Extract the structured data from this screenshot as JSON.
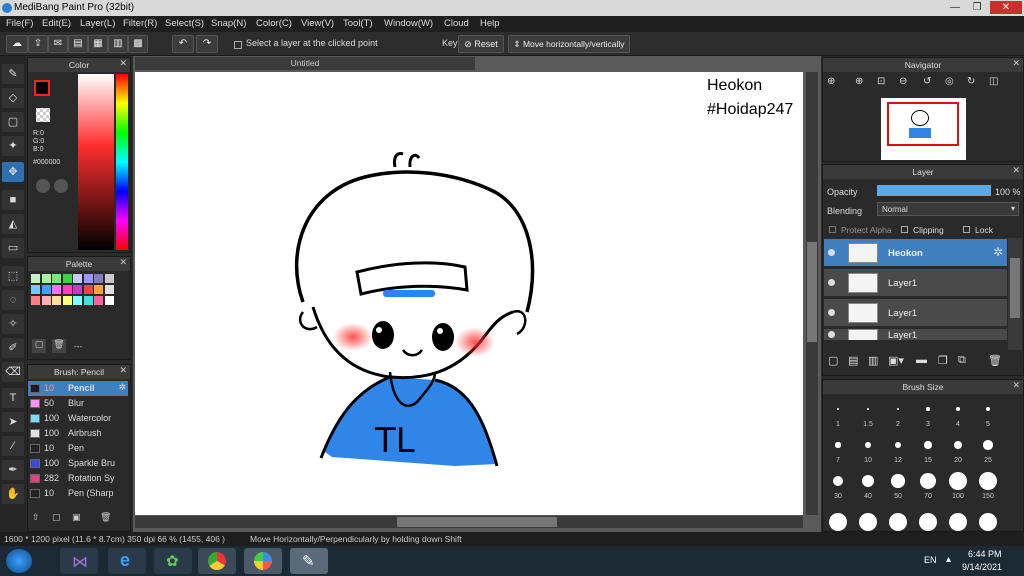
{
  "titlebar": {
    "title": "MediBang Paint Pro (32bit)"
  },
  "menu": [
    "File(F)",
    "Edit(E)",
    "Layer(L)",
    "Filter(R)",
    "Select(S)",
    "Snap(N)",
    "Color(C)",
    "View(V)",
    "Tool(T)",
    "Window(W)",
    "Cloud",
    "Help"
  ],
  "toolbar": {
    "select_layer_label": "Select a layer at the clicked point",
    "key_label": "Key",
    "reset_label": "Reset",
    "move_label": "Move horizontally/vertically"
  },
  "document": {
    "tab_title": "Untitled"
  },
  "canvas_text": {
    "line1": "Heokon",
    "line2": "#Hoidap247",
    "shirt_text": "TL"
  },
  "color_panel": {
    "title": "Color",
    "r": "R:0",
    "g": "G:0",
    "b": "B:0",
    "hex": "#000000",
    "primary": "#000000",
    "secondary": "#ff6600"
  },
  "palette_panel": {
    "title": "Palette",
    "swatches": [
      "#c8f0c8",
      "#a8f0a8",
      "#78e878",
      "#40d040",
      "#c8c8ff",
      "#9898ff",
      "#8080c0",
      "#c8c8c8",
      "#78c8ff",
      "#40a0ff",
      "#ff70ff",
      "#ff40c0",
      "#c040c0",
      "#ff4040",
      "#ffa040",
      "#e0e0e0",
      "#ff8080",
      "#ffb0b0",
      "#ffe0a0",
      "#ffff80",
      "#80ffff",
      "#40e0e0",
      "#ff60a0",
      "#ffffff"
    ],
    "footer": "---"
  },
  "brush_panel": {
    "title": "Brush: Pencil",
    "items": [
      {
        "size": "10",
        "name": "Pencil",
        "color": "#1a1a2a"
      },
      {
        "size": "50",
        "name": "Blur",
        "color": "#ff90ff"
      },
      {
        "size": "100",
        "name": "Watercolor",
        "color": "#80d8ff"
      },
      {
        "size": "100",
        "name": "Airbrush",
        "color": "#e0e0e0"
      },
      {
        "size": "10",
        "name": "Pen",
        "color": "#222222"
      },
      {
        "size": "100",
        "name": "Sparkle Bru",
        "color": "#3a4ad8"
      },
      {
        "size": "282",
        "name": "Rotation Sy",
        "color": "#e04080"
      },
      {
        "size": "10",
        "name": "Pen (Sharp",
        "color": "#222222"
      }
    ]
  },
  "navigator_panel": {
    "title": "Navigator"
  },
  "layer_panel": {
    "title": "Layer",
    "opacity_label": "Opacity",
    "opacity_value": "100 %",
    "opacity_fraction": 1.0,
    "blending_label": "Blending",
    "blending_value": "Normal",
    "protect_alpha_label": "Protect Alpha",
    "clipping_label": "Clipping",
    "lock_label": "Lock",
    "layers": [
      {
        "name": "Heokon",
        "selected": true
      },
      {
        "name": "Layer1",
        "selected": false
      },
      {
        "name": "Layer1",
        "selected": false
      },
      {
        "name": "Layer1",
        "selected": false
      }
    ]
  },
  "brush_size_panel": {
    "title": "Brush Size",
    "row1": [
      "1",
      "1.5",
      "2",
      "3",
      "4",
      "5"
    ],
    "row2": [
      "7",
      "10",
      "12",
      "15",
      "20",
      "25"
    ],
    "row3": [
      "30",
      "40",
      "50",
      "70",
      "100",
      "150"
    ]
  },
  "statusbar": {
    "dimensions": "1600 * 1200 pixel  (11.6 * 8.7cm)  350 dpi  66 %  (1455, 406 )",
    "hint": "Move Horizontally/Perpendicularly by holding down Shift"
  },
  "taskbar": {
    "lang": "EN",
    "time": "6:44 PM",
    "date": "9/14/2021"
  },
  "colors": {
    "accent": "#3f7fc0",
    "shirt": "#2f86e8",
    "bg": "#2b2b2b"
  }
}
